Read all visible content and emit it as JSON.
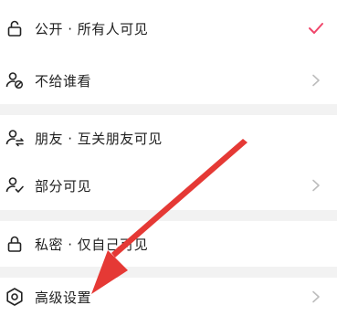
{
  "privacy_options": [
    {
      "label": "公开 · 所有人可见",
      "icon": "lock-open-icon",
      "selected": true
    },
    {
      "label": "不给谁看",
      "icon": "user-block-icon",
      "selected": false
    },
    {
      "label": "朋友 · 互关朋友可见",
      "icon": "user-friends-icon",
      "selected": false
    },
    {
      "label": "部分可见",
      "icon": "user-check-icon",
      "selected": false
    },
    {
      "label": "私密 · 仅自己可见",
      "icon": "lock-closed-icon",
      "selected": false
    },
    {
      "label": "高级设置",
      "icon": "settings-hexagon-icon",
      "selected": false
    }
  ],
  "colors": {
    "accent": "#f0456a",
    "annotation_arrow": "#e53935",
    "chevron": "#bdbdbd",
    "divider": "#f2f2f2"
  }
}
